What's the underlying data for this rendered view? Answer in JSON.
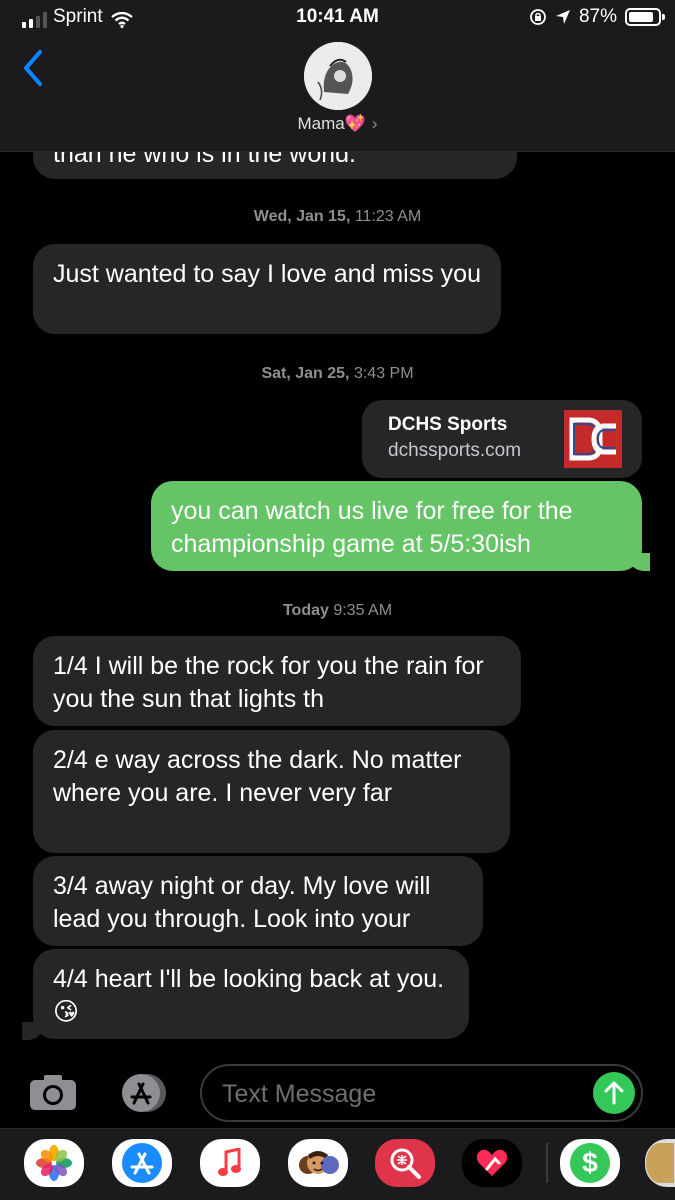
{
  "status_bar": {
    "carrier": "Sprint",
    "time": "10:41 AM",
    "battery": "87%",
    "battery_level": 0.87
  },
  "header": {
    "contact_name": "Mama💖",
    "chevron": "›"
  },
  "messages": {
    "partial_top": "than he who is in the world.",
    "stamp1_day": "Wed, Jan 15,",
    "stamp1_time": " 11:23 AM",
    "msg1": "Just wanted to say I love and miss you",
    "stamp2_day": "Sat, Jan 25,",
    "stamp2_time": " 3:43 PM",
    "link_title": "DCHS Sports",
    "link_domain": "dchssports.com",
    "msg_out": "you can watch us live for free for the championship game at 5/5:30ish",
    "stamp3_day": "Today",
    "stamp3_time": " 9:35 AM",
    "msg2": "1/4 I will be the rock for you the rain for you the sun that lights th",
    "msg3": "2/4 e way across the dark. No matter where you are.  I never very far",
    "msg4": "3/4 away night or day.  My love will lead you through.  Look into your",
    "msg5": "4/4  heart I'll be looking back at you.😘"
  },
  "input": {
    "placeholder": "Text Message"
  },
  "colors": {
    "incoming": "#262628",
    "outgoing": "#65c466",
    "accent": "#0a84ff"
  },
  "drawer": {
    "apps": [
      "photos-icon",
      "app-store-icon",
      "music-icon",
      "memoji-icon",
      "search-images-icon",
      "digital-touch-icon",
      "apple-pay-icon",
      "more-app-icon"
    ],
    "pay_symbol": "$"
  }
}
